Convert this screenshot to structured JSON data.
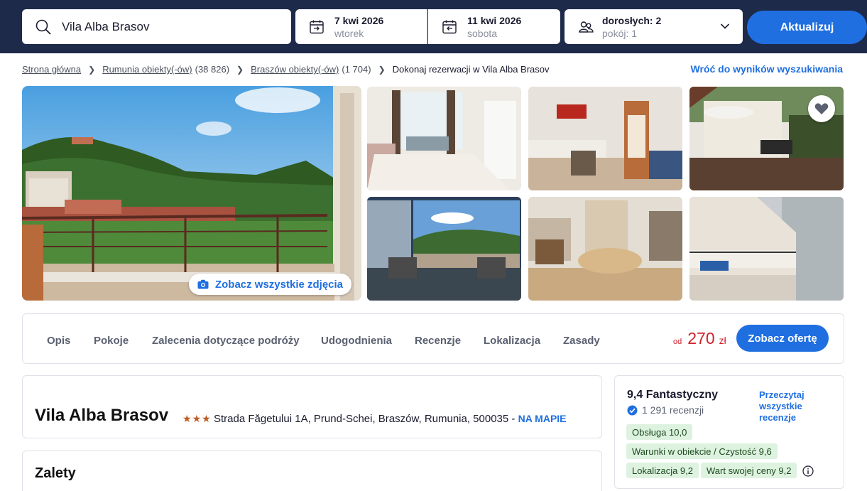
{
  "search": {
    "destination": "Vila Alba Brasov",
    "checkin_date": "7 kwi 2026",
    "checkin_day": "wtorek",
    "checkout_date": "11 kwi 2026",
    "checkout_day": "sobota",
    "guests": "dorosłych: 2",
    "rooms": "pokój: 1",
    "update_label": "Aktualizuj"
  },
  "breadcrumb": {
    "home": "Strona główna",
    "country": "Rumunia obiekty(-ów)",
    "country_count": "(38 826)",
    "city": "Braszów obiekty(-ów)",
    "city_count": "(1 704)",
    "current": "Dokonaj rezerwacji w Vila Alba Brasov",
    "back_link": "Wróć do wyników wyszukiwania"
  },
  "gallery": {
    "see_all_label": "Zobacz wszystkie zdjęcia",
    "favorite_icon": "heart-icon"
  },
  "nav": {
    "tabs": [
      "Opis",
      "Pokoje",
      "Zalecenia dotyczące podróży",
      "Udogodnienia",
      "Recenzje",
      "Lokalizacja",
      "Zasady"
    ],
    "price_prefix": "od",
    "price_amount": "270",
    "price_currency": "zł",
    "offer_label": "Zobacz ofertę",
    "price_color": "#d0212b"
  },
  "hotel": {
    "name": "Vila Alba Brasov",
    "stars": 3,
    "address": "Strada Făgetului 1A, Prund-Schei, Braszów, Rumunia, 500035",
    "address_sep": " - ",
    "map_link": "NA MAPIE"
  },
  "pros": {
    "title": "Zalety"
  },
  "rating": {
    "score_text": "9,4 Fantastyczny",
    "reviews_count": "1 291 recenzji",
    "read_all": "Przeczytaj wszystkie recenzje",
    "badges": [
      "Obsługa 10,0",
      "Warunki w obiekcie / Czystość 9,6",
      "Lokalizacja 9,2",
      "Wart swojej ceny 9,2"
    ]
  },
  "colors": {
    "topbar": "#1e2a4a",
    "accent": "#1f6fe0",
    "badge_bg": "#def2e0"
  }
}
